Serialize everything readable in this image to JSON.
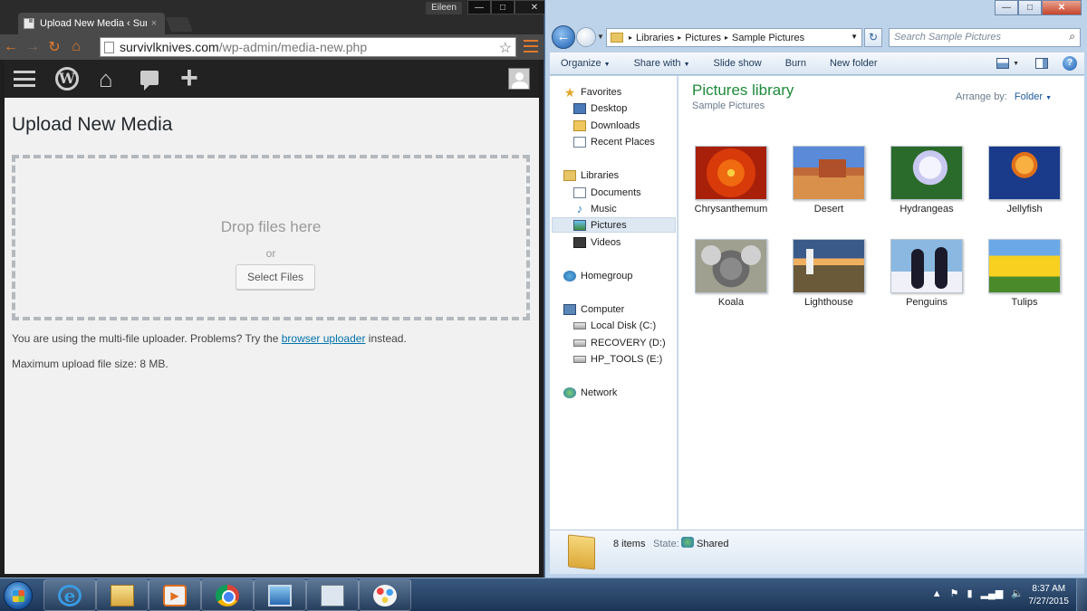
{
  "chrome": {
    "tab_title": "Upload New Media ‹ Surv",
    "tab_close": "×",
    "user_badge": "Eileen",
    "window_buttons": {
      "minimize": "—",
      "maximize": "□",
      "close": "✕"
    },
    "nav": {
      "back": "←",
      "forward": "→",
      "reload": "↻",
      "home": "⌂"
    },
    "url_host": "survivlknives.com",
    "url_path": "/wp-admin/media-new.php",
    "star": "☆"
  },
  "wordpress": {
    "adminbar": {
      "home_icon": "⌂",
      "plus_icon": "+"
    },
    "wplogo": "W",
    "page_title": "Upload New Media",
    "drop_text": "Drop files here",
    "or_text": "or",
    "select_files": "Select Files",
    "note_before": "You are using the multi-file uploader. Problems? Try the ",
    "note_link": "browser uploader",
    "note_after": " instead.",
    "max_size": "Maximum upload file size: 8 MB."
  },
  "explorer": {
    "window_buttons": {
      "minimize": "—",
      "maximize": "□",
      "close": "✕"
    },
    "back": "←",
    "history_caret": "▼",
    "breadcrumbs": [
      "Libraries",
      "Pictures",
      "Sample Pictures"
    ],
    "crumb_separator": "▸",
    "address_drop": "▼",
    "refresh": "↻",
    "search_placeholder": "Search Sample Pictures",
    "search_icon": "⌕",
    "commands": {
      "organize": "Organize",
      "share_with": "Share with",
      "slide_show": "Slide show",
      "burn": "Burn",
      "new_folder": "New folder",
      "caret": "▼",
      "help": "?"
    },
    "nav": {
      "favorites": "Favorites",
      "desktop": "Desktop",
      "downloads": "Downloads",
      "recent_places": "Recent Places",
      "libraries": "Libraries",
      "documents": "Documents",
      "music": "Music",
      "pictures": "Pictures",
      "videos": "Videos",
      "homegroup": "Homegroup",
      "computer": "Computer",
      "local_disk": "Local Disk (C:)",
      "recovery": "RECOVERY (D:)",
      "hp_tools": "HP_TOOLS (E:)",
      "network": "Network",
      "star_icon": "★",
      "music_icon": "♪"
    },
    "library_title": "Pictures library",
    "library_subtitle": "Sample Pictures",
    "arrange_by_label": "Arrange by:",
    "arrange_by_value": "Folder",
    "arrange_caret": "▼",
    "items": [
      {
        "name": "Chrysanthemum"
      },
      {
        "name": "Desert"
      },
      {
        "name": "Hydrangeas"
      },
      {
        "name": "Jellyfish"
      },
      {
        "name": "Koala"
      },
      {
        "name": "Lighthouse"
      },
      {
        "name": "Penguins"
      },
      {
        "name": "Tulips"
      }
    ],
    "details": {
      "count": "8 items",
      "state_label": "State:",
      "state_value": "Shared"
    }
  },
  "taskbar": {
    "ie_glyph": "e",
    "media_glyph": "▶",
    "tray": {
      "arrow": "▲",
      "flag": "⚑",
      "battery": "▮",
      "signal": "▂▄▆",
      "volume": "🔈"
    },
    "time": "8:37 AM",
    "date": "7/27/2015"
  }
}
